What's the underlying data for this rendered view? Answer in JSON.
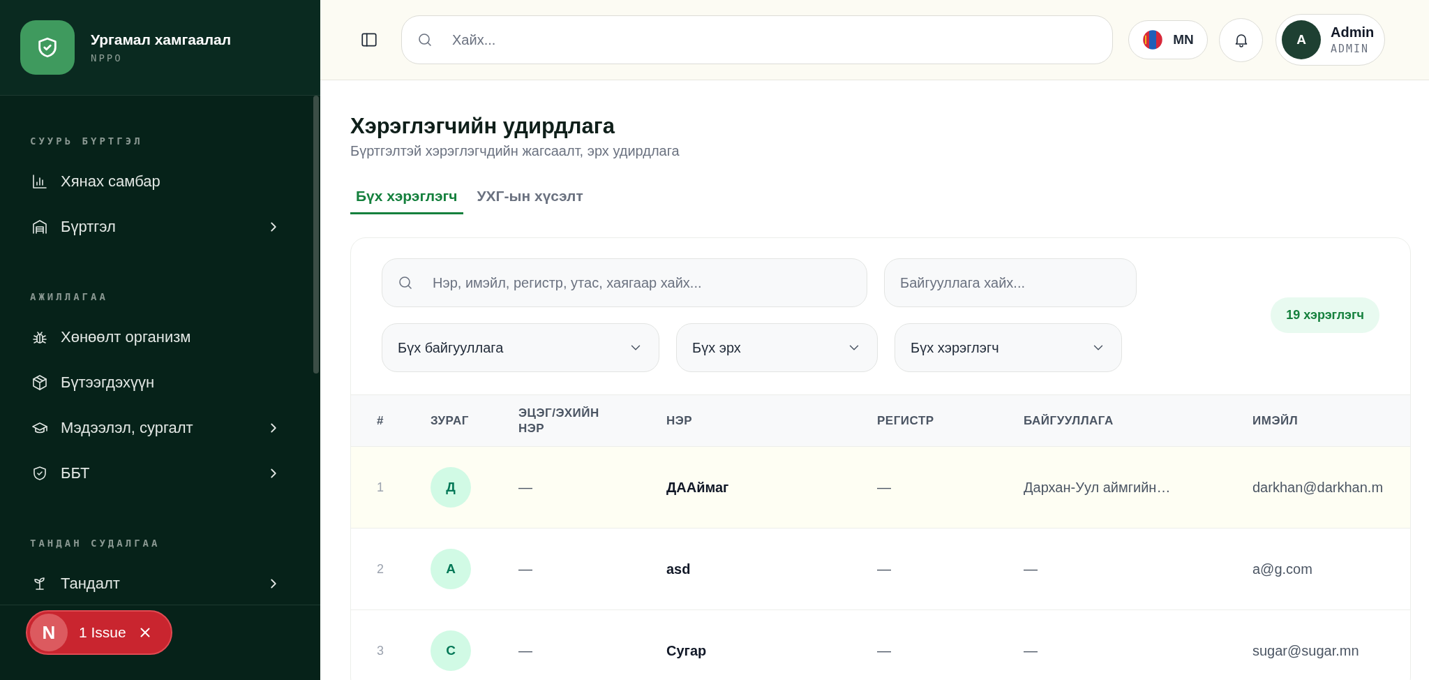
{
  "sidebar": {
    "brand": {
      "title": "Ургамал хамгаалал",
      "subtitle": "NPPO"
    },
    "sections": [
      {
        "label": "СУУРЬ БҮРТГЭЛ",
        "items": [
          {
            "label": "Хянах самбар",
            "expandable": false
          },
          {
            "label": "Бүртгэл",
            "expandable": true
          }
        ]
      },
      {
        "label": "АЖИЛЛАГАА",
        "items": [
          {
            "label": "Хөнөөлт организм",
            "expandable": false
          },
          {
            "label": "Бүтээгдэхүүн",
            "expandable": false
          },
          {
            "label": "Мэдээлэл, сургалт",
            "expandable": true
          },
          {
            "label": "ББТ",
            "expandable": true
          }
        ]
      },
      {
        "label": "ТАНДАН СУДАЛГАА",
        "items": [
          {
            "label": "Тандалт",
            "expandable": true
          }
        ]
      }
    ]
  },
  "issue_badge": {
    "logo": "N",
    "label": "1 Issue"
  },
  "header": {
    "search": {
      "placeholder": "Хайх..."
    },
    "language": "MN",
    "user": {
      "initial": "A",
      "name": "Admin",
      "role": "ADMIN"
    }
  },
  "page": {
    "title": "Хэрэглэгчийн удирдлага",
    "subtitle": "Бүртгэлтэй хэрэглэгчдийн жагсаалт, эрх удирдлага"
  },
  "tabs": [
    {
      "label": "Бүх хэрэглэгч",
      "selected": true
    },
    {
      "label": "УХГ-ын хүсэлт",
      "selected": false
    }
  ],
  "filters": {
    "search": {
      "placeholder": "Нэр, имэйл, регистр, утас, хаягаар хайх..."
    },
    "org_search": {
      "placeholder": "Байгууллага хайх..."
    },
    "dropdowns": [
      {
        "value": "Бүх байгууллага"
      },
      {
        "value": "Бүх эрх"
      },
      {
        "value": "Бүх хэрэглэгч"
      }
    ]
  },
  "count": "19 хэрэглэгч",
  "table": {
    "columns": [
      {
        "label": "#",
        "kind": "index"
      },
      {
        "label": "ЗУРАГ",
        "kind": "avatar"
      },
      {
        "label": "ЭЦЭГ/ЭХИЙН НЭР",
        "kind": "text"
      },
      {
        "label": "НЭР",
        "kind": "name"
      },
      {
        "label": "РЕГИСТР",
        "kind": "text"
      },
      {
        "label": "БАЙГУУЛЛАГА",
        "kind": "text"
      },
      {
        "label": "ИМЭЙЛ",
        "kind": "text"
      }
    ],
    "rows": [
      {
        "highlighted": true,
        "cells": [
          "1",
          "Д",
          "—",
          "ДААймаг",
          "—",
          "Дархан-Уул аймгийн…",
          "darkhan@darkhan.m"
        ]
      },
      {
        "highlighted": false,
        "cells": [
          "2",
          "A",
          "—",
          "asd",
          "—",
          "—",
          "a@g.com"
        ]
      },
      {
        "highlighted": false,
        "cells": [
          "3",
          "С",
          "—",
          "Сугар",
          "—",
          "—",
          "sugar@sugar.mn"
        ]
      }
    ]
  }
}
